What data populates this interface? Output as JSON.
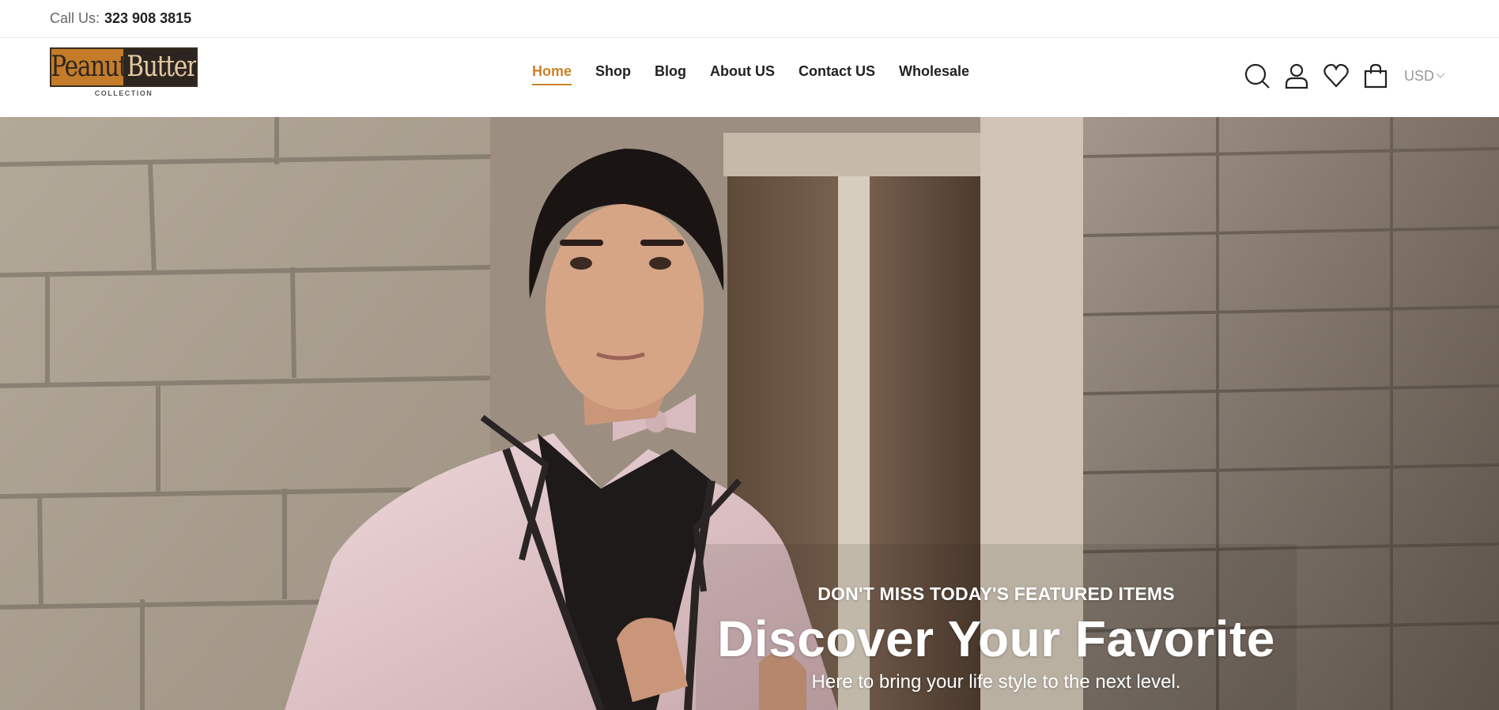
{
  "topbar": {
    "call_label": "Call Us:",
    "phone": "323 908 3815"
  },
  "logo": {
    "word1": "Peanut",
    "word2": "Butter",
    "sub": "COLLECTION"
  },
  "nav": {
    "items": [
      {
        "label": "Home",
        "active": true
      },
      {
        "label": "Shop"
      },
      {
        "label": "Blog"
      },
      {
        "label": "About US"
      },
      {
        "label": "Contact US"
      },
      {
        "label": "Wholesale"
      }
    ]
  },
  "header_icons": {
    "search": "search-icon",
    "account": "user-icon",
    "wishlist": "heart-icon",
    "cart": "shopping-bag-icon",
    "currency": "USD"
  },
  "hero": {
    "eyebrow": "DON'T MISS TODAY'S FEATURED ITEMS",
    "title": "Discover Your Favorite",
    "subtitle": "Here to bring your life style to the next level."
  },
  "colors": {
    "accent": "#c9812c",
    "text": "#222222",
    "muted": "#999999"
  }
}
